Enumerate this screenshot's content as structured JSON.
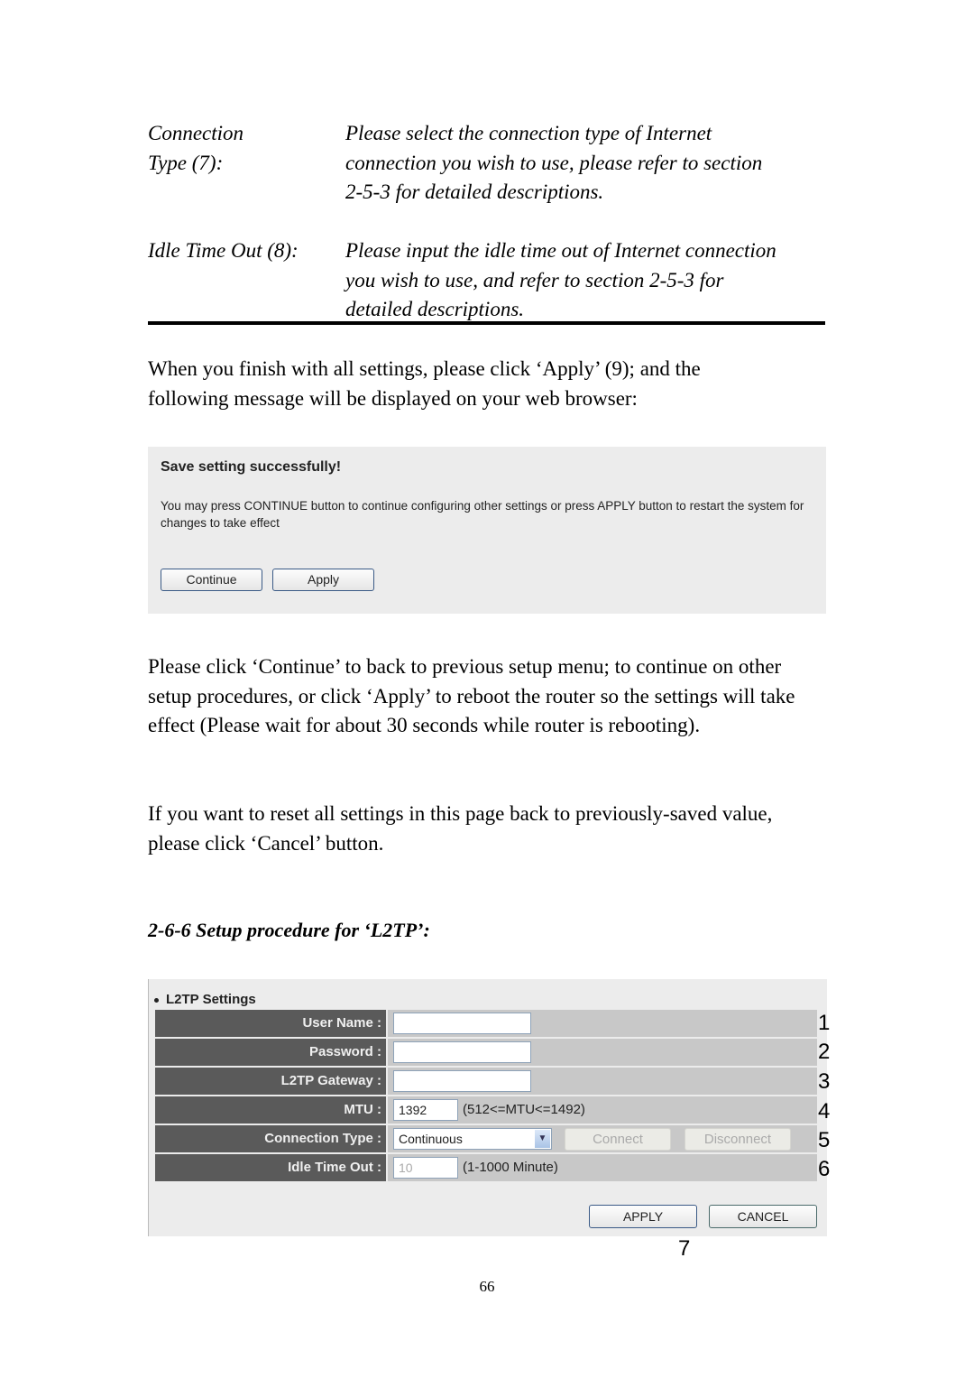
{
  "definitions": [
    {
      "label_lines": [
        "Connection",
        "Type (7):"
      ],
      "text_lines": [
        "Please select the connection type of Internet",
        "connection you wish to use, please refer to section",
        "2-5-3 for detailed descriptions."
      ]
    },
    {
      "label_lines": [
        "Idle Time Out (8):"
      ],
      "text_lines": [
        "Please input the idle time out of Internet connection",
        "you wish to use, and refer to section 2-5-3 for",
        "detailed descriptions."
      ]
    }
  ],
  "paragraphs": {
    "apply_intro": "When you finish with all settings, please click ‘Apply’ (9); and the following message will be displayed on your web browser:",
    "continue_info": "Please click ‘Continue’ to back to previous setup menu; to continue on other setup procedures, or click ‘Apply’ to reboot the router so the settings will take effect (Please wait for about 30 seconds while router is rebooting).",
    "cancel_info": "If you want to reset all settings in this page back to previously-saved value, please click ‘Cancel’ button."
  },
  "save_dialog": {
    "title": "Save setting successfully!",
    "message": "You may press CONTINUE button to continue configuring other settings or press APPLY button to restart the system for changes to take effect",
    "continue_label": "Continue",
    "apply_label": "Apply"
  },
  "section_heading": "2-6-6 Setup procedure for ‘L2TP’:",
  "l2tp": {
    "title": "L2TP Settings",
    "user_name": {
      "label": "User Name :",
      "value": ""
    },
    "password": {
      "label": "Password :",
      "value": ""
    },
    "gateway": {
      "label": "L2TP Gateway :",
      "value": ""
    },
    "mtu": {
      "label": "MTU :",
      "value": "1392",
      "hint": "(512<=MTU<=1492)"
    },
    "connection_type": {
      "label": "Connection Type :",
      "selected": "Continuous",
      "connect_label": "Connect",
      "disconnect_label": "Disconnect"
    },
    "idle_time_out": {
      "label": "Idle Time Out :",
      "value": "10",
      "hint": "(1-1000 Minute)"
    },
    "apply_label": "APPLY",
    "cancel_label": "CANCEL"
  },
  "markers": [
    "1",
    "2",
    "3",
    "4",
    "5",
    "6",
    "7"
  ],
  "page_number": "66"
}
